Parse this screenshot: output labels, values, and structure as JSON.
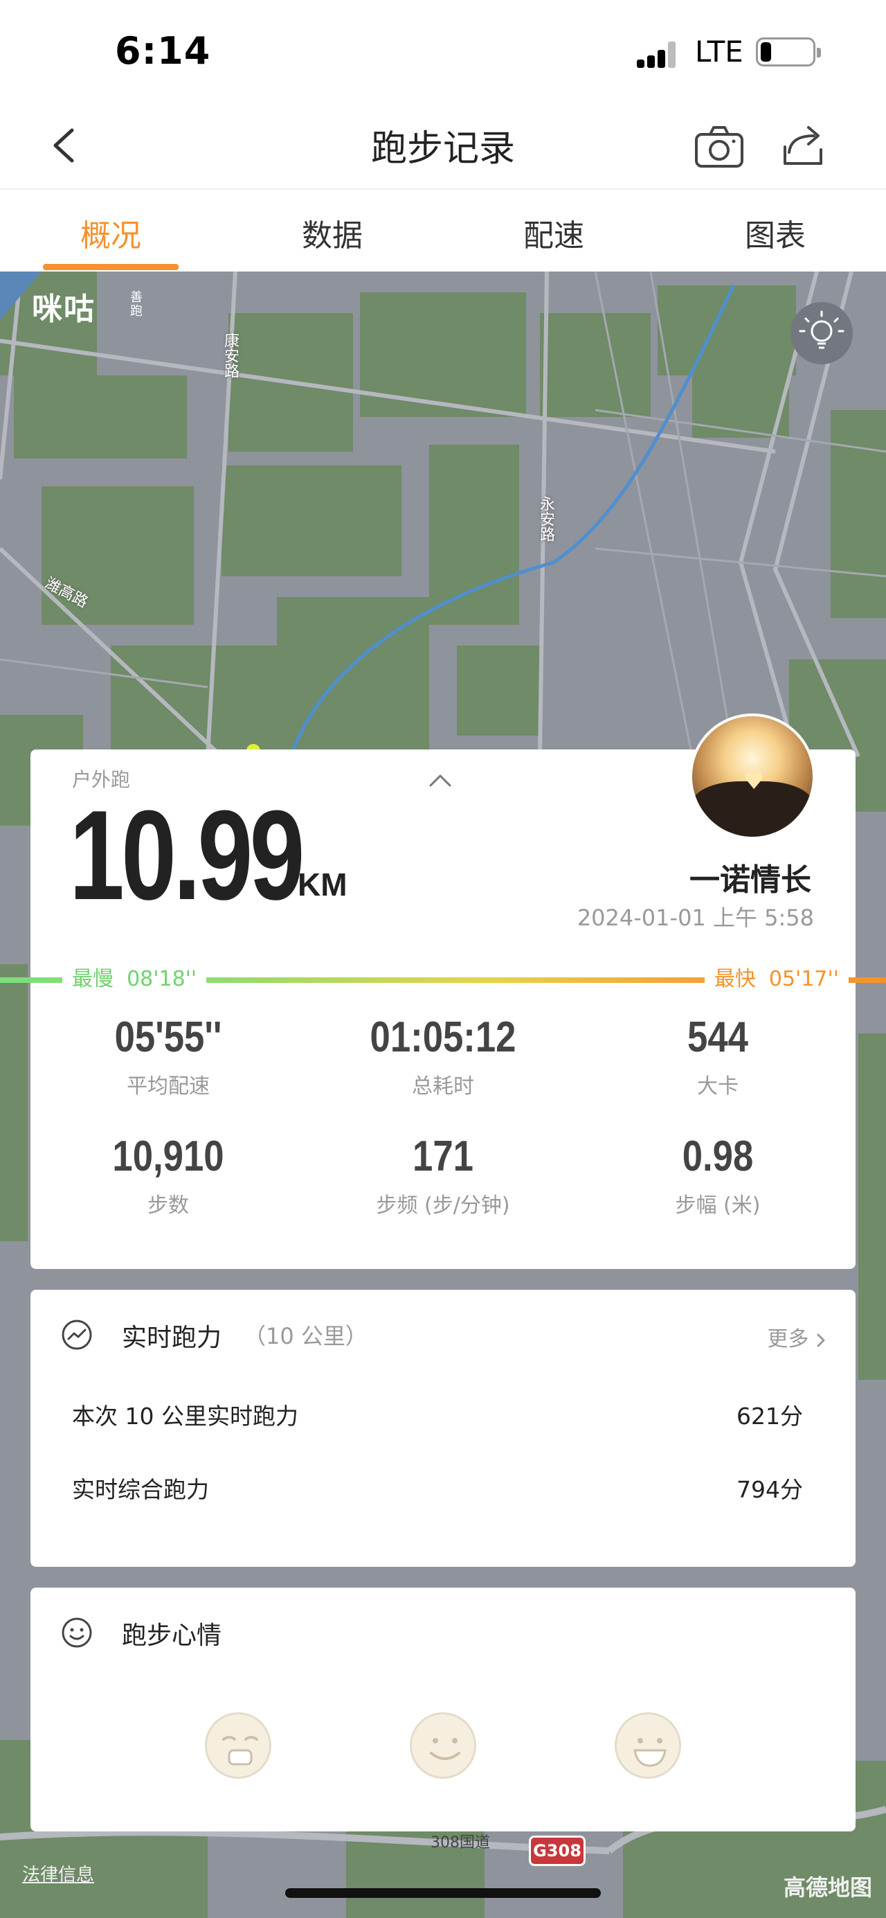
{
  "status_bar": {
    "time": "6:14",
    "network": "LTE",
    "battery_percent": 20
  },
  "nav": {
    "title": "跑步记录",
    "back_icon": "chevron-left-icon",
    "camera_icon": "camera-icon",
    "share_icon": "share-icon"
  },
  "tabs": [
    {
      "label": "概况",
      "active": true
    },
    {
      "label": "数据",
      "active": false
    },
    {
      "label": "配速",
      "active": false
    },
    {
      "label": "图表",
      "active": false
    }
  ],
  "map": {
    "brand": "咪咕",
    "brand_sub": "善跑",
    "roads": [
      "康安路",
      "永安路",
      "潍高路",
      "308国道"
    ],
    "shield": "G308",
    "credit": "高德地图",
    "legal": "法律信息",
    "light_icon": "lightbulb-icon"
  },
  "summary": {
    "sport_type": "户外跑",
    "distance": "10.99",
    "distance_unit": "KM",
    "nickname": "一诺情长",
    "date": "2024-01-01 上午 5:58",
    "slowest_label": "最慢",
    "slowest_pace": "08'18''",
    "fastest_label": "最快",
    "fastest_pace": "05'17''",
    "stats": [
      {
        "value": "05'55''",
        "label": "平均配速"
      },
      {
        "value": "01:05:12",
        "label": "总耗时"
      },
      {
        "value": "544",
        "label": "大卡"
      },
      {
        "value": "10,910",
        "label": "步数"
      },
      {
        "value": "171",
        "label": "步频 (步/分钟)"
      },
      {
        "value": "0.98",
        "label": "步幅 (米)"
      }
    ]
  },
  "power": {
    "title": "实时跑力",
    "subtitle": "（10 公里）",
    "more": "更多",
    "rows": [
      {
        "label": "本次 10 公里实时跑力",
        "value": "621分"
      },
      {
        "label": "实时综合跑力",
        "value": "794分"
      }
    ]
  },
  "mood": {
    "title": "跑步心情",
    "faces": [
      "tired-face-icon",
      "smile-face-icon",
      "grin-face-icon"
    ]
  }
}
